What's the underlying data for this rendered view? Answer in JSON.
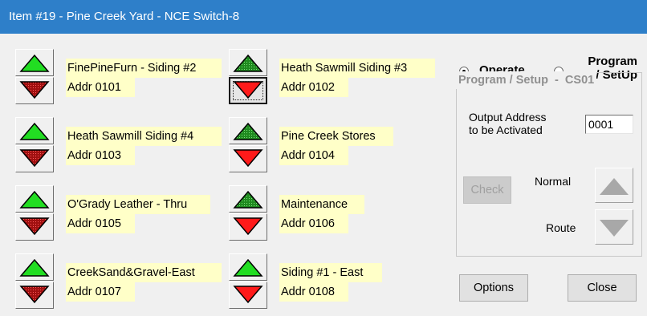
{
  "window": {
    "title": "Item #19 - Pine Creek Yard - NCE Switch-8"
  },
  "switches": [
    {
      "name": "FinePineFurn - Siding #2",
      "addr": "Addr 0101"
    },
    {
      "name": "Heath Sawmill Siding #3",
      "addr": "Addr 0102"
    },
    {
      "name": "Heath Sawmill Siding #4",
      "addr": "Addr 0103"
    },
    {
      "name": "Pine Creek Stores",
      "addr": "Addr 0104"
    },
    {
      "name": "O'Grady Leather - Thru",
      "addr": "Addr 0105"
    },
    {
      "name": "Maintenance",
      "addr": "Addr 0106"
    },
    {
      "name": "CreekSand&Gravel-East",
      "addr": "Addr 0107"
    },
    {
      "name": "Siding #1 - East",
      "addr": "Addr 0108"
    }
  ],
  "mode": {
    "operate_label": "Operate",
    "program_label_line1": "Program",
    "program_label_line2": "/ SetUp",
    "selected": "Operate"
  },
  "program": {
    "group_title": "Program / Setup  -  CS01",
    "output_label_line1": "Output Address",
    "output_label_line2": "to be Activated",
    "output_value": "0001",
    "check_label": "Check",
    "normal_label": "Normal",
    "route_label": "Route"
  },
  "buttons": {
    "options_label": "Options",
    "close_label": "Close"
  },
  "colors": {
    "titlebar": "#2e7fc9",
    "label_bg": "#ffffc8",
    "active_green": "#22dd22",
    "active_red": "#ff1a1a",
    "inactive_green": "#1f8a1f",
    "inactive_red": "#a01010"
  }
}
